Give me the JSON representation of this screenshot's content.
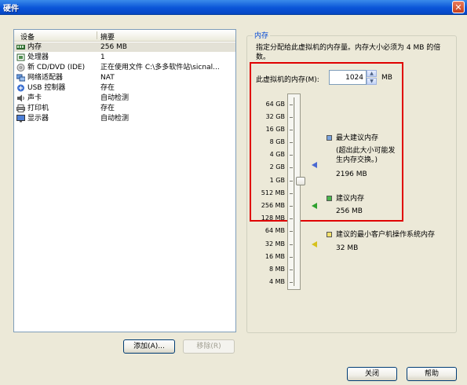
{
  "window": {
    "title": "硬件",
    "close_glyph": "✕"
  },
  "device_list": {
    "headers": {
      "device": "设备",
      "summary": "摘要"
    },
    "rows": [
      {
        "icon": "memory-icon",
        "name": "内存",
        "summary": "256 MB",
        "selected": true
      },
      {
        "icon": "processor-icon",
        "name": "处理器",
        "summary": "1"
      },
      {
        "icon": "cd-dvd-icon",
        "name": "新 CD/DVD (IDE)",
        "summary": "正在使用文件 C:\\多多软件站\\sicnal..."
      },
      {
        "icon": "network-adapter-icon",
        "name": "网络适配器",
        "summary": "NAT"
      },
      {
        "icon": "usb-controller-icon",
        "name": "USB 控制器",
        "summary": "存在"
      },
      {
        "icon": "sound-card-icon",
        "name": "声卡",
        "summary": "自动检测"
      },
      {
        "icon": "printer-icon",
        "name": "打印机",
        "summary": "存在"
      },
      {
        "icon": "display-icon",
        "name": "显示器",
        "summary": "自动检测"
      }
    ],
    "add_button": "添加(A)...",
    "remove_button": "移除(R)"
  },
  "memory": {
    "group_title": "内存",
    "description": "指定分配给此虚拟机的内存量。内存大小必须为 4 MB 的倍数。",
    "field_label": "此虚拟机的内存(M):",
    "value": "1024",
    "unit": "MB",
    "slider_ticks": [
      "64 GB",
      "32 GB",
      "16 GB",
      "8 GB",
      "4 GB",
      "2 GB",
      "1 GB",
      "512 MB",
      "256 MB",
      "128 MB",
      "64 MB",
      "32 MB",
      "16 MB",
      "8 MB",
      "4 MB"
    ],
    "slider_selected": "1 GB",
    "legend": {
      "max_title": "最大建议内存",
      "max_note": "(超出此大小可能发生内存交换。)",
      "max_value": "2196 MB",
      "rec_title": "建议内存",
      "rec_value": "256 MB",
      "min_title": "建议的最小客户机操作系统内存",
      "min_value": "32 MB"
    },
    "colors": {
      "max": "#4a69d2",
      "recommended": "#2fa12f",
      "minimum": "#d6c11d"
    }
  },
  "footer": {
    "close_button": "关闭",
    "help_button": "帮助"
  }
}
